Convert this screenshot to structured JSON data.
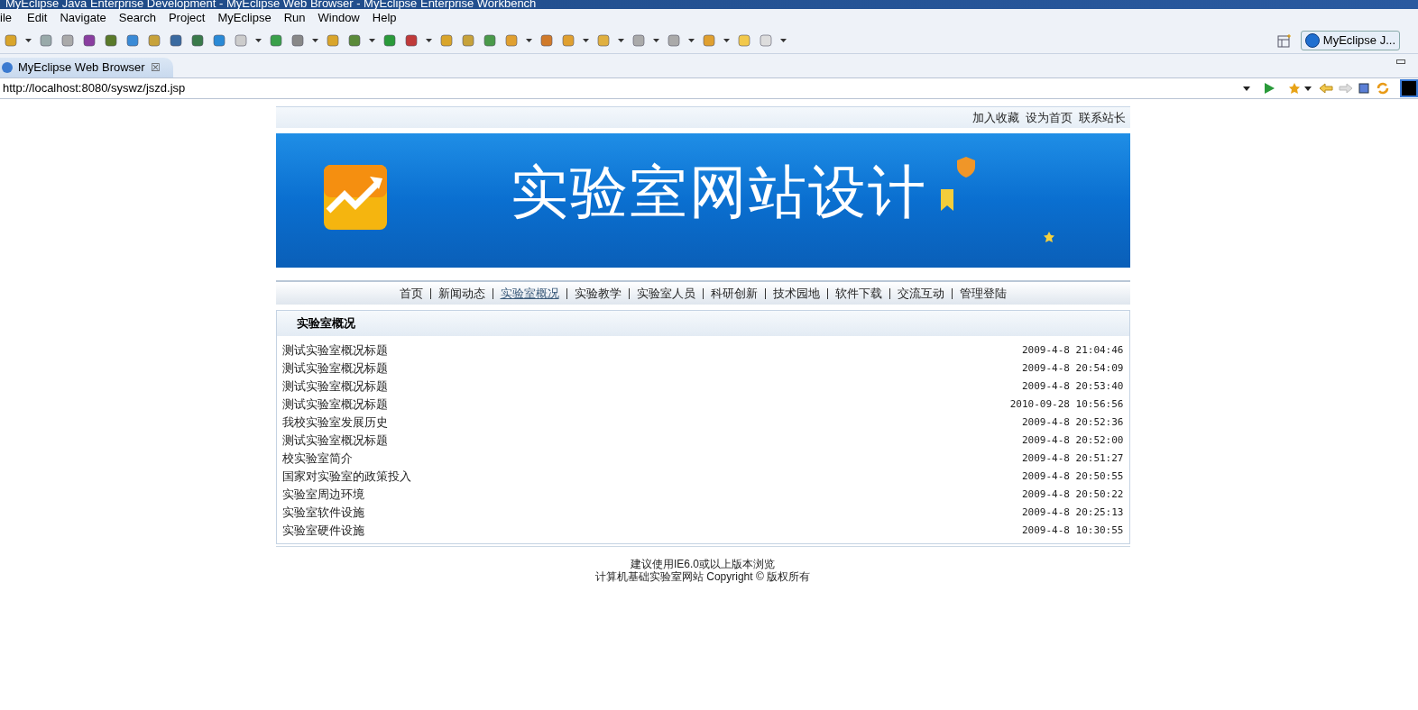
{
  "window": {
    "title": "MyEclipse Java Enterprise Development - MyEclipse Web Browser - MyEclipse Enterprise Workbench"
  },
  "menu": [
    "ile",
    "Edit",
    "Navigate",
    "Search",
    "Project",
    "MyEclipse",
    "Run",
    "Window",
    "Help"
  ],
  "perspective": {
    "label": "MyEclipse J..."
  },
  "editor_tab": {
    "label": "MyEclipse Web Browser",
    "close": "☒"
  },
  "address": {
    "value": "http://localhost:8080/syswz/jszd.jsp"
  },
  "site": {
    "top_links": [
      "加入收藏",
      "设为首页",
      "联系站长"
    ],
    "banner_title": "实验室网站设计",
    "nav": [
      {
        "label": "首页",
        "selected": false
      },
      {
        "label": "新闻动态",
        "selected": false
      },
      {
        "label": "实验室概况",
        "selected": true
      },
      {
        "label": "实验教学",
        "selected": false
      },
      {
        "label": "实验室人员",
        "selected": false
      },
      {
        "label": "科研创新",
        "selected": false
      },
      {
        "label": "技术园地",
        "selected": false
      },
      {
        "label": "软件下载",
        "selected": false
      },
      {
        "label": "交流互动",
        "selected": false
      },
      {
        "label": "管理登陆",
        "selected": false
      }
    ],
    "panel_title": "实验室概况",
    "articles": [
      {
        "title": "测试实验室概况标题",
        "date": "2009-4-8 21:04:46"
      },
      {
        "title": "测试实验室概况标题",
        "date": "2009-4-8 20:54:09"
      },
      {
        "title": "测试实验室概况标题",
        "date": "2009-4-8 20:53:40"
      },
      {
        "title": "测试实验室概况标题",
        "date": "2010-09-28 10:56:56"
      },
      {
        "title": "我校实验室发展历史",
        "date": "2009-4-8 20:52:36"
      },
      {
        "title": "测试实验室概况标题",
        "date": "2009-4-8 20:52:00"
      },
      {
        "title": "校实验室简介",
        "date": "2009-4-8 20:51:27"
      },
      {
        "title": "国家对实验室的政策投入",
        "date": "2009-4-8 20:50:55"
      },
      {
        "title": "实验室周边环境",
        "date": "2009-4-8 20:50:22"
      },
      {
        "title": "实验室软件设施",
        "date": "2009-4-8 20:25:13"
      },
      {
        "title": "实验室硬件设施",
        "date": "2009-4-8 10:30:55"
      }
    ],
    "footer": [
      "建议使用IE6.0或以上版本浏览",
      "计算机基础实验室网站 Copyright © 版权所有"
    ]
  }
}
